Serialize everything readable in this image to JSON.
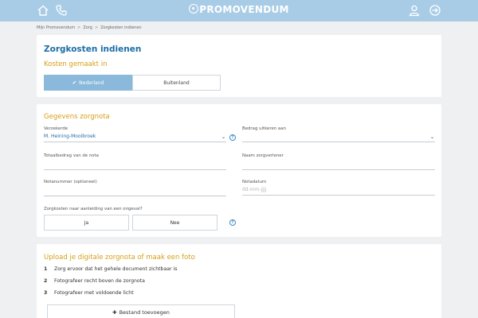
{
  "header": {
    "brand": "PROMOVENDUM",
    "icons": [
      "home-icon",
      "phone-icon",
      "user-icon",
      "logout-icon"
    ]
  },
  "breadcrumb": [
    "Mijn Promovendum",
    "Zorg",
    "Zorgkosten indienen"
  ],
  "section1": {
    "title": "Zorgkosten indienen",
    "subtitle": "Kosten gemaakt in",
    "options": [
      {
        "label": "Nederland",
        "selected": true
      },
      {
        "label": "Buitenland",
        "selected": false
      }
    ]
  },
  "section2": {
    "title": "Gegevens zorgnota",
    "fields": {
      "verzekerde_label": "Verzekerde",
      "verzekerde_value": "M. Heining-Mooibroek",
      "bedrag_label": "Bedrag uitkeren aan",
      "bedrag_value": "",
      "totaal_label": "Totaalbedrag van de nota",
      "totaal_value": "",
      "zorgverlener_label": "Naam zorgverlener",
      "zorgverlener_value": "",
      "notanummer_label": "Notanummer (optioneel)",
      "notanummer_value": "",
      "notadatum_label": "Notadatum",
      "notadatum_placeholder": "dd-mm-jjjj"
    },
    "ongeval_question": "Zorgkosten naar aanleiding van een ongeval?",
    "ongeval_yes": "Ja",
    "ongeval_no": "Nee"
  },
  "section3": {
    "title": "Upload je digitale zorgnota of maak een foto",
    "steps": [
      {
        "num": "1",
        "text": "Zorg ervoor dat het gehele document zichtbaar is"
      },
      {
        "num": "2",
        "text": "Fotografeer recht boven de zorgnota"
      },
      {
        "num": "3",
        "text": "Fotografeer met voldoende licht"
      }
    ],
    "add_button": "Bestand toevoegen"
  },
  "colors": {
    "header_bg": "#a8cce6",
    "title_blue": "#1d6ea8",
    "accent_gold": "#d4a017",
    "selected_option": "#8ab9dc"
  }
}
